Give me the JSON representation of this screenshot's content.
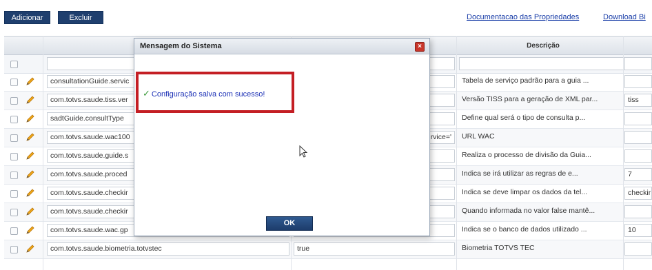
{
  "toolbar": {
    "add_label": "Adicionar",
    "delete_label": "Excluir",
    "docs_link": "Documentacao das Propriedades",
    "download_link": "Download Bi"
  },
  "grid": {
    "header": {
      "description": "Descrição"
    },
    "rows": [
      {
        "name": "consultationGuide.servic",
        "value": "",
        "description": "Tabela de serviço padrão para a guia ...",
        "extra": ""
      },
      {
        "name": "com.totvs.saude.tiss.ver",
        "value": "",
        "description": "Versão TISS para a geração de XML par...",
        "extra": "tiss"
      },
      {
        "name": "sadtGuide.consultType",
        "value": "",
        "description": "Define qual será o tipo de consulta p...",
        "extra": ""
      },
      {
        "name": "com.totvs.saude.wac100",
        "value": "rvice='",
        "description": "URL WAC",
        "extra": ""
      },
      {
        "name": "com.totvs.saude.guide.s",
        "value": "",
        "description": "Realiza o processo de divisão da Guia...",
        "extra": ""
      },
      {
        "name": "com.totvs.saude.proced",
        "value": "",
        "description": "Indica se irá utilizar as regras de e...",
        "extra": "7"
      },
      {
        "name": "com.totvs.saude.checkir",
        "value": "",
        "description": "Indica se deve limpar os dados da tel...",
        "extra": "checkir"
      },
      {
        "name": "com.totvs.saude.checkir",
        "value": "",
        "description": "Quando informada no valor false mantê...",
        "extra": ""
      },
      {
        "name": "com.totvs.saude.wac.gp",
        "value": "",
        "description": "Indica se o banco de dados utilizado ...",
        "extra": "10"
      },
      {
        "name": "com.totvs.saude.biometria.totvstec",
        "value": "true",
        "description": "Biometria TOTVS TEC",
        "extra": ""
      }
    ]
  },
  "dialog": {
    "title": "Mensagem do Sistema",
    "message": "Configuração salva com sucesso!",
    "ok_label": "OK",
    "close_icon": "close-icon",
    "success_icon": "checkmark-icon",
    "highlight_color": "#c41e24"
  },
  "colors": {
    "button_bg": "#1f3f6e",
    "link": "#1a3ea8",
    "message_text": "#1a2fb5"
  }
}
